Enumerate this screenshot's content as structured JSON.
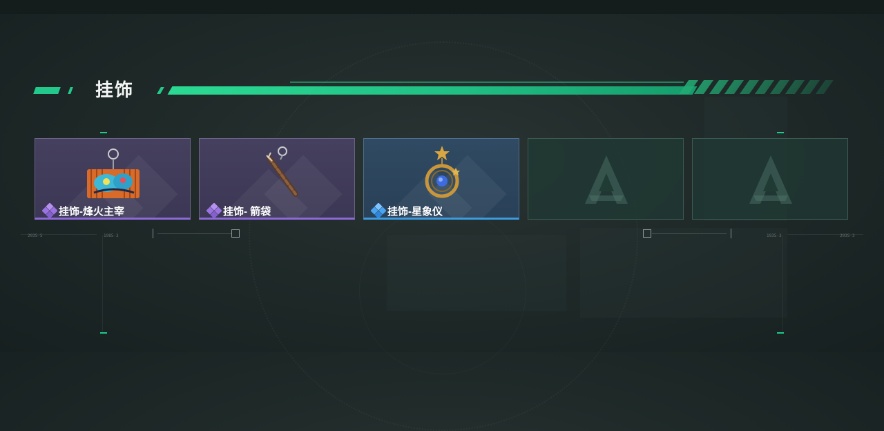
{
  "section": {
    "title": "挂饰"
  },
  "items": [
    {
      "name": "挂饰-烽火主宰",
      "rarity": "purple",
      "icon": "fire-lord-charm-icon"
    },
    {
      "name": "挂饰- 箭袋",
      "rarity": "purple",
      "icon": "quiver-charm-icon"
    },
    {
      "name": "挂饰-星象仪",
      "rarity": "blue",
      "icon": "astrolabe-charm-icon"
    },
    {
      "name": "",
      "rarity": "empty",
      "icon": "logo-placeholder-icon"
    },
    {
      "name": "",
      "rarity": "empty",
      "icon": "logo-placeholder-icon"
    }
  ],
  "ruler_labels": [
    "2035-5",
    "1985-3",
    "1935-3",
    "2035-3"
  ],
  "colors": {
    "accent": "#23c98a",
    "purple_rarity": "#8e6ad8",
    "blue_rarity": "#3d9be0"
  }
}
